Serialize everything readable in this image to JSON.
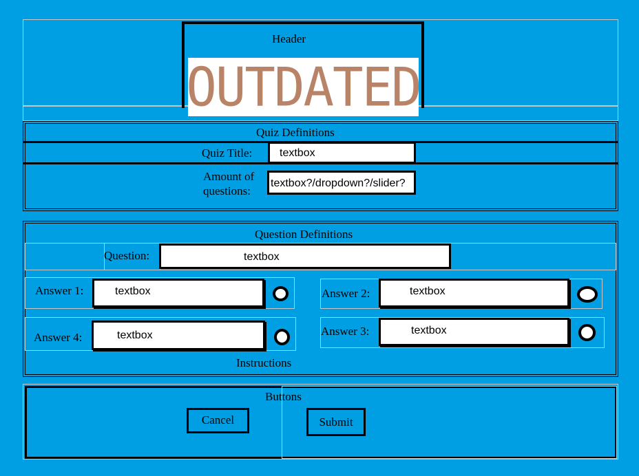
{
  "header": {
    "label": "Header",
    "stamp": "OUTDATED"
  },
  "quiz_definitions": {
    "title": "Quiz Definitions",
    "quiz_title_label": "Quiz Title:",
    "quiz_title_value": "textbox",
    "amount_label_line1": "Amount of",
    "amount_label_line2": "questions:",
    "amount_value": "textbox?/dropdown?/slider?"
  },
  "question_definitions": {
    "title": "Question Definitions",
    "question_label": "Question:",
    "question_value": "textbox",
    "answers": [
      {
        "label": "Answer 1:",
        "value": "textbox"
      },
      {
        "label": "Answer 2:",
        "value": "textbox"
      },
      {
        "label": "Answer 3:",
        "value": "textbox"
      },
      {
        "label": "Answer 4:",
        "value": "textbox"
      }
    ],
    "instructions": "Instructions"
  },
  "buttons": {
    "title": "Buttons",
    "cancel": "Cancel",
    "submit": "Submit"
  },
  "colors": {
    "background": "#009fe3",
    "stamp": "#b88366"
  }
}
